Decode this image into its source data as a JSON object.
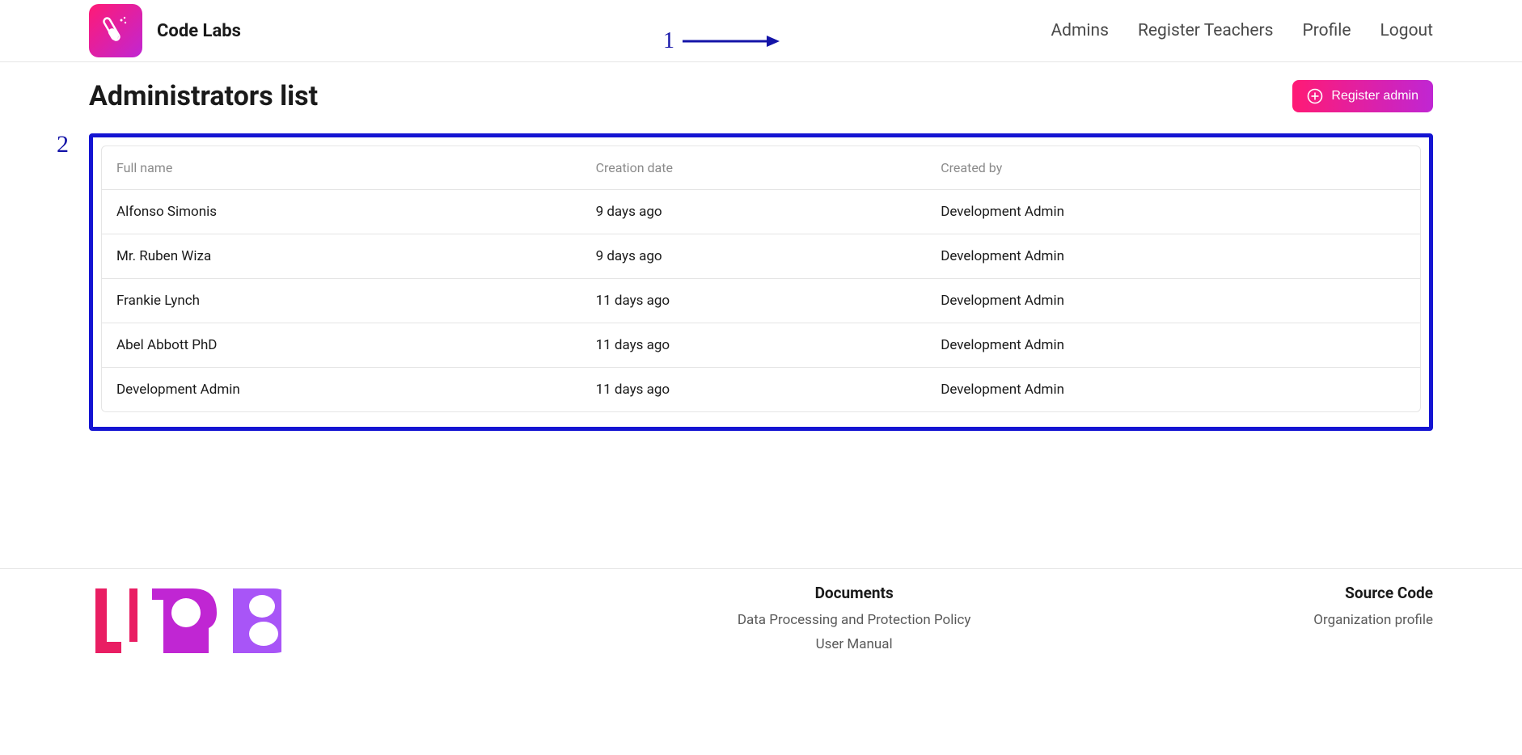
{
  "brand": {
    "name": "Code Labs"
  },
  "nav": {
    "admins": "Admins",
    "register_teachers": "Register Teachers",
    "profile": "Profile",
    "logout": "Logout"
  },
  "annotations": {
    "label_1": "1",
    "label_2": "2"
  },
  "page": {
    "title": "Administrators list",
    "register_button": "Register admin"
  },
  "table": {
    "headers": {
      "full_name": "Full name",
      "creation_date": "Creation date",
      "created_by": "Created by"
    },
    "rows": [
      {
        "name": "Alfonso Simonis",
        "date": "9 days ago",
        "by": "Development Admin"
      },
      {
        "name": "Mr. Ruben Wiza",
        "date": "9 days ago",
        "by": "Development Admin"
      },
      {
        "name": "Frankie Lynch",
        "date": "11 days ago",
        "by": "Development Admin"
      },
      {
        "name": "Abel Abbott PhD",
        "date": "11 days ago",
        "by": "Development Admin"
      },
      {
        "name": "Development Admin",
        "date": "11 days ago",
        "by": "Development Admin"
      }
    ]
  },
  "footer": {
    "documents": {
      "heading": "Documents",
      "link1": "Data Processing and Protection Policy",
      "link2": "User Manual"
    },
    "source": {
      "heading": "Source Code",
      "link1": "Organization profile"
    }
  }
}
